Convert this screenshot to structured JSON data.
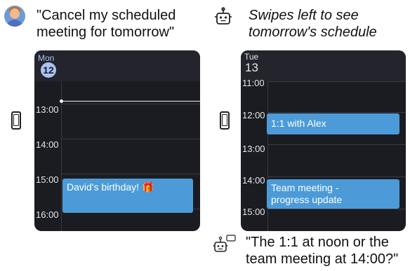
{
  "user": {
    "utterance_line1": "\"Cancel my scheduled",
    "utterance_line2": "meeting for tomorrow\""
  },
  "agent_action": {
    "line1": "Swipes left to see",
    "line2": "tomorrow's schedule"
  },
  "agent_reply": {
    "line1": "\"The 1:1 at noon or the",
    "line2": "team meeting at 14:00?\""
  },
  "left_screen": {
    "day_name": "Mon",
    "day_number": "12",
    "hours": [
      "13:00",
      "14:00",
      "15:00",
      "16:00"
    ],
    "events": [
      {
        "title": "David's birthday! 🎁"
      }
    ]
  },
  "right_screen": {
    "day_name": "Tue",
    "day_number": "13",
    "hours": [
      "11:00",
      "12:00",
      "13:00",
      "14:00",
      "15:00"
    ],
    "events": [
      {
        "title": "1:1 with Alex"
      },
      {
        "title_line1": "Team meeting -",
        "title_line2": "progress update"
      }
    ]
  },
  "colors": {
    "panel_bg": "#1b1c22",
    "event_bg": "#4c9bd8",
    "today_badge": "#a9c3f3"
  }
}
